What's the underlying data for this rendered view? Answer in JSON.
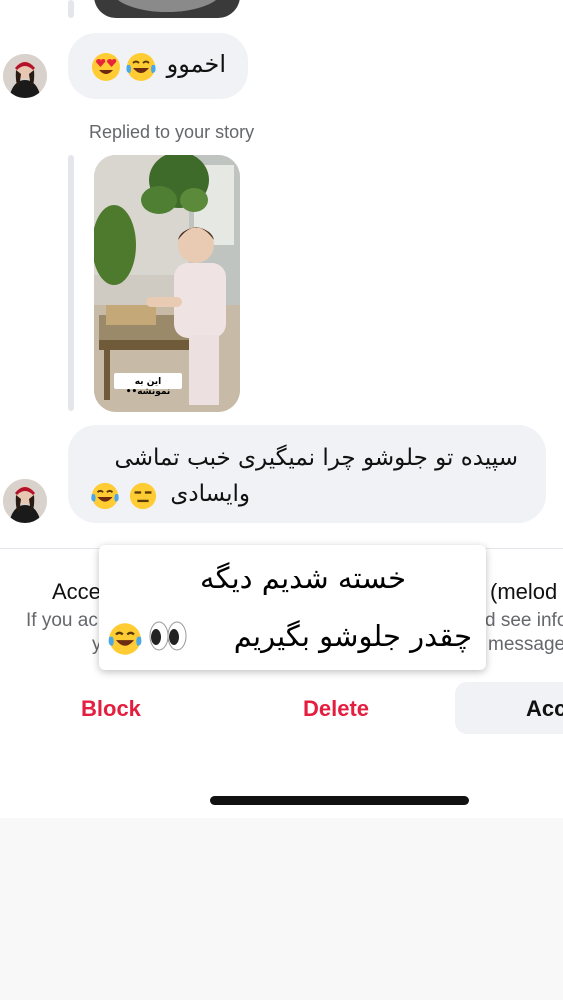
{
  "messages": {
    "first_text": "اخموو",
    "story_reply_label": "Replied to your story",
    "story_caption": "این به نمونشه••",
    "second_text_line1": "سپیده تو جلوشو چرا نمیگیری خبب تماشی",
    "second_text_line2": "وایسادی"
  },
  "request_panel": {
    "title_left": "Acce",
    "title_right": "(melod",
    "info_left_1": "If you ac",
    "info_right_1": "d see info",
    "info_left_2": "y",
    "info_right_2": "message"
  },
  "overlay": {
    "line1": "خسته شدیم دیگه",
    "line2": "چقدر جلوشو بگیریم"
  },
  "actions": {
    "block": "Block",
    "delete": "Delete",
    "accept": "Acc"
  },
  "colors": {
    "danger": "#e41e3f",
    "bubble": "#f0f2f5",
    "muted": "#65676b"
  },
  "icons": [
    "heart-eyes-emoji",
    "tears-of-joy-emoji",
    "expressionless-emoji",
    "eyes-emoji"
  ]
}
